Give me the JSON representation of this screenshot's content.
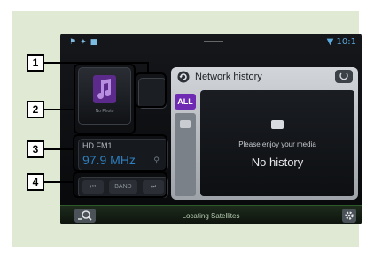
{
  "status_bar": {
    "clock": "10:1"
  },
  "left": {
    "cover_text": "No Photo",
    "freq_name": "HD FM1",
    "freq_value": "97.9 MHz",
    "controls": {
      "prev": "⏮",
      "band": "BAND",
      "next": "⏭"
    }
  },
  "network_history": {
    "title": "Network history",
    "all_label": "ALL",
    "message": "Please enjoy your media",
    "empty": "No history"
  },
  "bottom_bar": {
    "status": "Locating Satellites"
  },
  "callouts": [
    "1",
    "2",
    "3",
    "4"
  ],
  "colors": {
    "accent_purple": "#6f2ab3",
    "frequency_blue": "#2e7fc0",
    "panel_green": "#dfe9d3"
  }
}
